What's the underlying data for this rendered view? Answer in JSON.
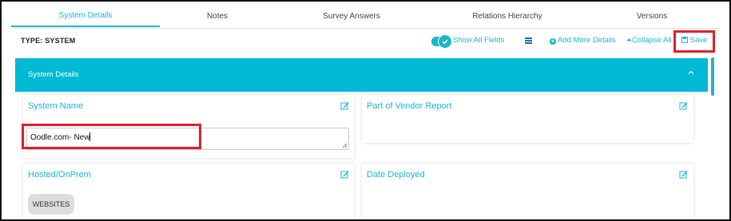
{
  "tabs": [
    {
      "label": "System Details",
      "active": true
    },
    {
      "label": "Notes",
      "active": false
    },
    {
      "label": "Survey Answers",
      "active": false
    },
    {
      "label": "Relations Hierarchy",
      "active": false
    },
    {
      "label": "Versions",
      "active": false
    }
  ],
  "toolbar": {
    "type_label": "TYPE: SYSTEM",
    "show_all_fields": "Show All Fields",
    "show_all_fields_on": true,
    "add_more_details": "Add More Details",
    "collapse_all": "Collapse All",
    "save": "Save"
  },
  "section": {
    "title": "System Details"
  },
  "fields": {
    "system_name": {
      "label": "System Name",
      "value": "Oodle.com- New"
    },
    "part_of_vendor_report": {
      "label": "Part of Vendor Report"
    },
    "hosted_onprem": {
      "label": "Hosted/OnPrem",
      "chip": "WEBSITES"
    },
    "date_deployed": {
      "label": "Date Deployed"
    }
  },
  "colors": {
    "accent": "#1db5cc",
    "header": "#00b9d4",
    "highlight": "#e01e2c"
  },
  "icons": [
    "check-icon",
    "menu-icon",
    "plus-circle-icon",
    "caret-up-icon",
    "save-icon",
    "chevron-up-icon",
    "edit-icon",
    "resize-grip-icon"
  ]
}
